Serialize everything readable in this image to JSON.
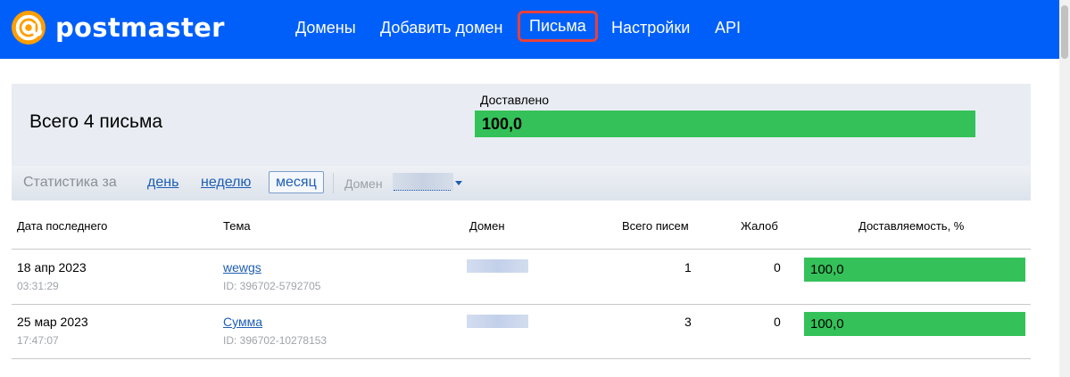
{
  "header": {
    "logo_text": "postmaster",
    "nav": [
      {
        "label": "Домены"
      },
      {
        "label": "Добавить домен"
      },
      {
        "label": "Письма",
        "active": true
      },
      {
        "label": "Настройки"
      },
      {
        "label": "API"
      }
    ],
    "accent_color": "#005ff9",
    "highlight_color": "#e8403b"
  },
  "summary": {
    "total_text": "Всего 4 письма",
    "delivered_label": "Доставлено",
    "delivered_value": "100,0",
    "bar_color": "#34c15a"
  },
  "filters": {
    "period_label": "Статистика за",
    "options": [
      "день",
      "неделю",
      "месяц"
    ],
    "active_option": "месяц",
    "domain_label": "Домен"
  },
  "table": {
    "columns": [
      "Дата последнего",
      "Тема",
      "Домен",
      "Всего писем",
      "Жалоб",
      "Доставляемость, %"
    ],
    "rows": [
      {
        "date": "18 апр 2023",
        "time": "03:31:29",
        "subject": "wewgs",
        "id": "ID: 396702-5792705",
        "total": "1",
        "complaints": "0",
        "deliverability": "100,0",
        "deliverability_fraction": 1.0
      },
      {
        "date": "25 мар 2023",
        "time": "17:47:07",
        "subject": "Сумма",
        "id": "ID: 396702-10278153",
        "total": "3",
        "complaints": "0",
        "deliverability": "100,0",
        "deliverability_fraction": 1.0
      }
    ]
  }
}
